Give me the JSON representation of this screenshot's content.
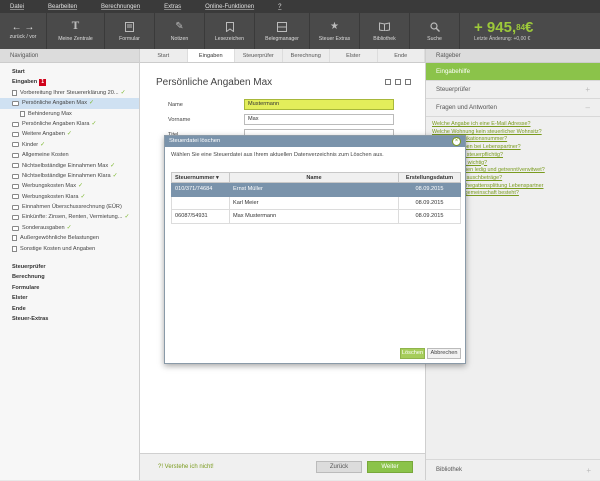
{
  "menu": [
    "Datei",
    "Bearbeiten",
    "Berechnungen",
    "Extras",
    "Online-Funktionen",
    "?"
  ],
  "toolbar": {
    "nav_label": "zurück / vor",
    "items": [
      {
        "label": "Meine Zentrale",
        "icon": "text-icon"
      },
      {
        "label": "Formular",
        "icon": "form-icon"
      },
      {
        "label": "Notizen",
        "icon": "pencil-icon"
      },
      {
        "label": "Lesezeichen",
        "icon": "bookmark-icon"
      },
      {
        "label": "Belegmanager",
        "icon": "receipt-icon"
      },
      {
        "label": "Steuer Extras",
        "icon": "star-icon"
      },
      {
        "label": "Bibliothek",
        "icon": "book-icon"
      },
      {
        "label": "Suche",
        "icon": "search-icon"
      }
    ],
    "amount_main": "+ 945,",
    "amount_cents": "84",
    "amount_currency": "€",
    "last_change": "Letzte Änderung: +0,00 €"
  },
  "leftnav": {
    "title": "Navigation",
    "items": [
      {
        "label": "Start",
        "bold": true
      },
      {
        "label": "Eingaben",
        "bold": true,
        "badge": "1"
      },
      {
        "label": "Vorbereitung Ihrer Steuererklärung 20...",
        "icon": "doc",
        "check": true
      },
      {
        "label": "Persönliche Angaben Max",
        "icon": "folder",
        "check": true,
        "selected": true
      },
      {
        "label": "Behinderung Max",
        "icon": "doc",
        "indent": true
      },
      {
        "label": "Persönliche Angaben Klara",
        "icon": "folder",
        "check": true
      },
      {
        "label": "Weitere Angaben",
        "icon": "folder",
        "check": true
      },
      {
        "label": "Kinder",
        "icon": "folder",
        "check": true
      },
      {
        "label": "Allgemeine Kosten",
        "icon": "folder"
      },
      {
        "label": "Nichtselbständige Einnahmen Max",
        "icon": "folder",
        "check": true
      },
      {
        "label": "Nichtselbständige Einnahmen Klara",
        "icon": "folder",
        "check": true
      },
      {
        "label": "Werbungskosten Max",
        "icon": "folder",
        "check": true
      },
      {
        "label": "Werbungskosten Klara",
        "icon": "folder",
        "check": true
      },
      {
        "label": "Einnahmen Überschussrechnung (EÜR)",
        "icon": "folder"
      },
      {
        "label": "Einkünfte: Zinsen, Renten, Vermietung...",
        "icon": "folder",
        "check": true
      },
      {
        "label": "Sonderausgaben",
        "icon": "folder",
        "check": true
      },
      {
        "label": "Außergewöhnliche Belastungen",
        "icon": "doc"
      },
      {
        "label": "Sonstige Kosten und Angaben",
        "icon": "doc"
      },
      {
        "label": "",
        "spacer": true
      },
      {
        "label": "Steuerprüfer",
        "bold": true
      },
      {
        "label": "Berechnung",
        "bold": true
      },
      {
        "label": "Formulare",
        "bold": true
      },
      {
        "label": "Elster",
        "bold": true
      },
      {
        "label": "Ende",
        "bold": true
      },
      {
        "label": "Steuer-Extras",
        "bold": true
      }
    ]
  },
  "tabs": [
    "Start",
    "Eingaben",
    "Steuerprüfer",
    "Berechnung",
    "Elster",
    "Ende"
  ],
  "page": {
    "title": "Persönliche Angaben Max",
    "fields": [
      {
        "label": "Name",
        "value": "Mustermann",
        "highlight": true
      },
      {
        "label": "Vorname",
        "value": "Max"
      },
      {
        "label": "Titel",
        "value": ""
      }
    ]
  },
  "bottom": {
    "help_link": "?! Verstehe ich nicht!",
    "back": "Zurück",
    "next": "Weiter"
  },
  "rightpane": {
    "title": "Ratgeber",
    "sections": [
      {
        "label": "Eingabehilfe",
        "green": true
      },
      {
        "label": "Steuerprüfer"
      },
      {
        "label": "Fragen und Antworten"
      }
    ],
    "links": [
      "Welche Angabe ich eine E-Mail Adresse?",
      "Welche Wohnung kein steuerlicher Wohnsitz?",
      "Welche Identifikationsnummer?",
      "Welche Angaben bei Lebenspartner?",
      "Unbeschränkt steuerpflichtig?",
      "Geburtsdatum wichtig?",
      "Was ist zwischen ledig und getrennt/verwitwet?",
      "Behinderten-Pauschbeträge?",
      "Wird bei der Ehegattensplittung Lebenspartner",
      "ob eine Gütergemeinschaft besteht?"
    ],
    "bottom": "Bibliothek"
  },
  "dialog": {
    "title": "Steuerdatei löschen",
    "instruction": "Wählen Sie eine Steuerdatei aus Ihrem aktuellen Datenverzeichnis zum Löschen aus.",
    "columns": [
      "Steuernummer",
      "Name",
      "Erstellungsdatum"
    ],
    "rows": [
      {
        "steuernummer": "010/371/74684",
        "name": "Ernst Müller",
        "datum": "08.09.2015",
        "selected": true
      },
      {
        "steuernummer": "",
        "name": "Karl Meier",
        "datum": "08.09.2015"
      },
      {
        "steuernummer": "06087/54931",
        "name": "Max Mustermann",
        "datum": "08.09.2015"
      }
    ],
    "ok": "Löschen",
    "cancel": "Abbrechen"
  }
}
